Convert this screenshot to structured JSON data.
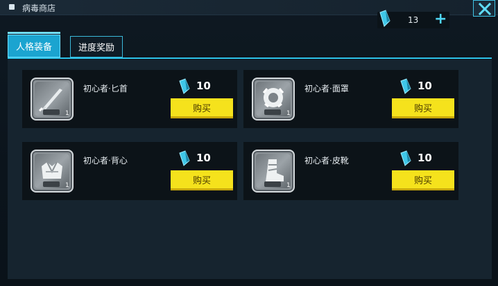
{
  "header": {
    "title": "病毒商店",
    "close_icon": "close-x-icon"
  },
  "currency": {
    "icon": "crystal-icon",
    "amount": "13",
    "add_label": "+"
  },
  "tabs": [
    {
      "label": "人格装备",
      "active": true
    },
    {
      "label": "进度奖励",
      "active": false
    }
  ],
  "items": [
    {
      "name": "初心者·匕首",
      "icon": "dagger-icon",
      "count": "1",
      "price": "10",
      "buy_label": "购买"
    },
    {
      "name": "初心者·面罩",
      "icon": "mask-icon",
      "count": "1",
      "price": "10",
      "buy_label": "购买"
    },
    {
      "name": "初心者·背心",
      "icon": "vest-icon",
      "count": "1",
      "price": "10",
      "buy_label": "购买"
    },
    {
      "name": "初心者·皮靴",
      "icon": "boots-icon",
      "count": "1",
      "price": "10",
      "buy_label": "购买"
    }
  ],
  "colors": {
    "accent": "#2cc4ea",
    "buy": "#f5e21c",
    "tab_active": "#1ba4d0"
  }
}
